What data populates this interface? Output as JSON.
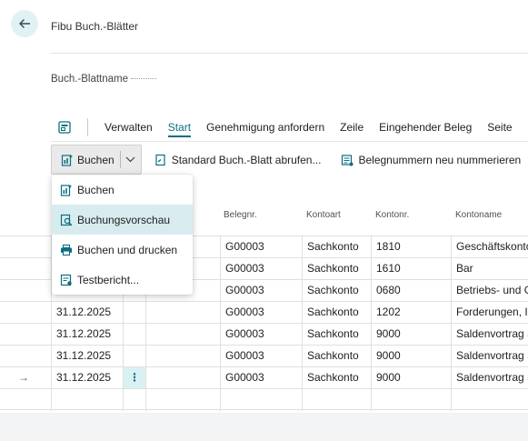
{
  "header": {
    "title": "Fibu Buch.-Blätter",
    "field_label": "Buch.-Blattname"
  },
  "action_bar": {
    "tabs": [
      "Verwalten",
      "Start",
      "Genehmigung anfordern",
      "Zeile",
      "Eingehender Beleg",
      "Seite"
    ],
    "active_tab": "Start"
  },
  "command_bar": {
    "post_label": "Buchen",
    "standard_label": "Standard Buch.-Blatt abrufen...",
    "renumber_label": "Belegnummern neu nummerieren"
  },
  "post_menu": {
    "items": [
      "Buchen",
      "Buchungsvorschau",
      "Buchen und drucken",
      "Testbericht..."
    ],
    "highlighted": "Buchungsvorschau"
  },
  "grid": {
    "columns": [
      "Belegnr.",
      "Kontoart",
      "Kontonr.",
      "Kontoname"
    ],
    "rows": [
      {
        "date": "",
        "doc": "G00003",
        "type": "Sachkonto",
        "no": "1810",
        "name": "Geschäftskonto"
      },
      {
        "date": "",
        "doc": "G00003",
        "type": "Sachkonto",
        "no": "1610",
        "name": "Bar"
      },
      {
        "date": "31.12.2025",
        "doc": "G00003",
        "type": "Sachkonto",
        "no": "0680",
        "name": "Betriebs- und G"
      },
      {
        "date": "31.12.2025",
        "doc": "G00003",
        "type": "Sachkonto",
        "no": "1202",
        "name": "Forderungen, In"
      },
      {
        "date": "31.12.2025",
        "doc": "G00003",
        "type": "Sachkonto",
        "no": "9000",
        "name": "Saldenvortrag S"
      },
      {
        "date": "31.12.2025",
        "doc": "G00003",
        "type": "Sachkonto",
        "no": "9000",
        "name": "Saldenvortrag S"
      },
      {
        "date": "31.12.2025",
        "doc": "G00003",
        "type": "Sachkonto",
        "no": "9000",
        "name": "Saldenvortrag S"
      }
    ],
    "current_row_marker": "→",
    "row_menu_glyph": "⋮"
  },
  "colors": {
    "accent": "#0a6f80",
    "hover": "#d8ecf0",
    "back_button_bg": "#e2f2f4"
  }
}
